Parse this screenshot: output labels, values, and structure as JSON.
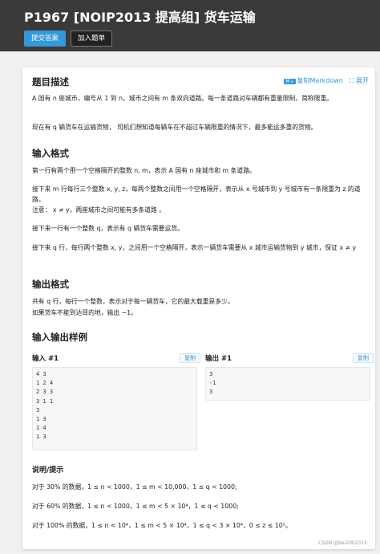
{
  "problem": {
    "title": "P1967 [NOIP2013 提高组] 货车运输"
  },
  "actions": {
    "submit": "提交答案",
    "add_to_list": "加入题单"
  },
  "toolbar": {
    "copy_markdown": "复制Markdown",
    "expand": "展开"
  },
  "sections": {
    "desc_title": "题目描述",
    "desc_p1": "A 国有 n 座城市，编号从 1 到 n，城市之间有 m 条双向道路。每一条道路对车辆都有重量限制，简称限重。",
    "desc_p2": "现在有 q 辆货车在运输货物， 司机们想知道每辆车在不超过车辆限重的情况下，最多能运多重的货物。",
    "input_title": "输入格式",
    "input_p1": "第一行有两个用一个空格隔开的整数 n, m，表示 A 国有 n 座城市和 m 条道路。",
    "input_p2": "接下来 m 行每行三个整数 x, y, z，每两个整数之间用一个空格隔开，表示从 x 号城市到 y 号城市有一条限重为 z 的道路。",
    "input_p2_note": "注意： x ≠ y，两座城市之间可能有多条道路 。",
    "input_p3": "接下来一行有一个整数 q，表示有 q 辆货车需要运货。",
    "input_p4": "接下来 q 行，每行两个整数 x, y，之间用一个空格隔开，表示一辆货车需要从 x 城市运输货物到 y 城市，保证 x ≠ y",
    "output_title": "输出格式",
    "output_p1": "共有 q 行，每行一个整数，表示对于每一辆货车，它的最大载重是多少。",
    "output_p2": "如果货车不能到达目的地，输出 −1。",
    "samples_title": "输入输出样例",
    "hint_title": "说明/提示",
    "hint_1": "对于 30% 的数据，1 ≤ n < 1000，1 ≤ m < 10,000，1 ≤ q < 1000;",
    "hint_2": "对于 60% 的数据，1 ≤ n < 1000，1 ≤ m < 5 × 10⁴，1 ≤ q < 1000;",
    "hint_3": "对于 100% 的数据，1 ≤ n < 10⁴，1 ≤ m < 5 × 10⁴，1 ≤ q < 3 × 10⁴，0 ≤ z ≤ 10⁵。"
  },
  "samples": {
    "input_label": "输入 #1",
    "output_label": "输出 #1",
    "copy_label": "复制",
    "input_text": "4 3\n1 2 4\n2 3 3\n3 1 1\n3\n1 3\n1 4\n1 3",
    "output_text": "3\n-1\n3"
  },
  "watermark": "CSDN @bei2002315"
}
